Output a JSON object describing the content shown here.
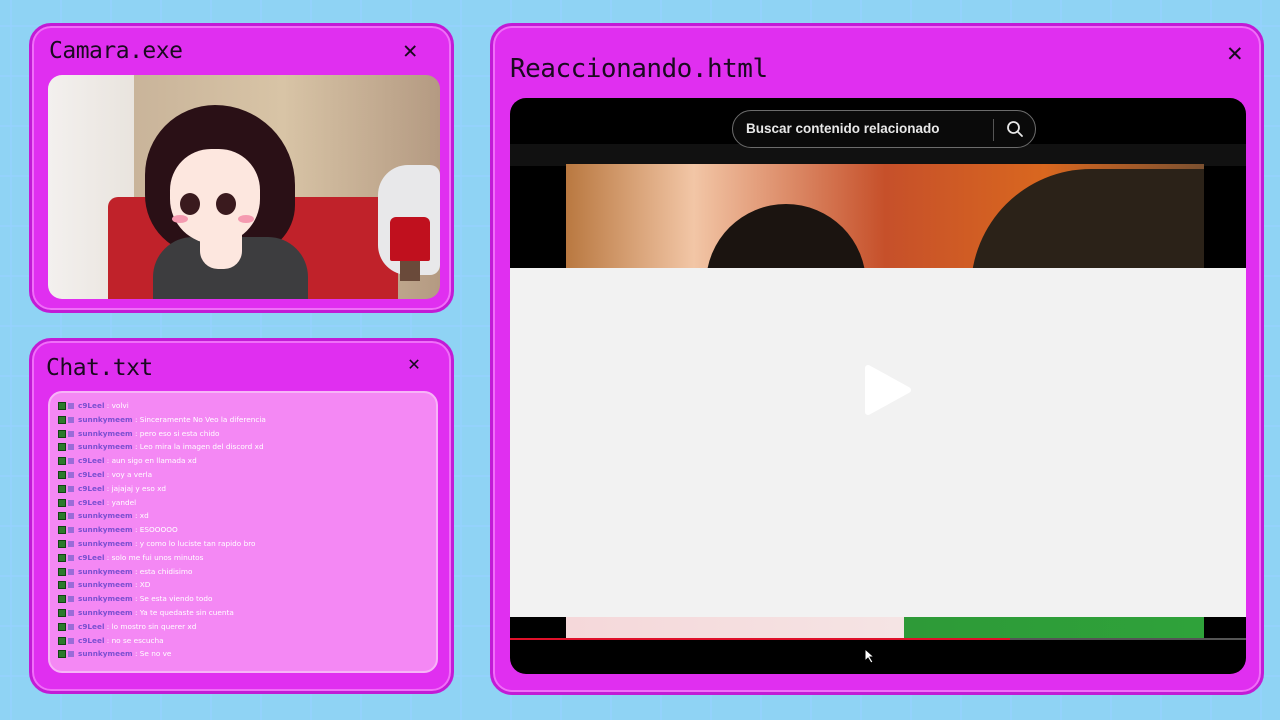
{
  "camera_window": {
    "title": "Camara.exe",
    "close": "✕"
  },
  "chat_window": {
    "title": "Chat.txt",
    "close": "✕",
    "messages": [
      {
        "user": "c9Leel",
        "text": "volvi"
      },
      {
        "user": "sunnkymeem",
        "text": "Sinceramente No Veo la diferencia"
      },
      {
        "user": "sunnkymeem",
        "text": "pero eso si esta chido"
      },
      {
        "user": "sunnkymeem",
        "text": "Leo mira la imagen del discord xd"
      },
      {
        "user": "c9Leel",
        "text": "aun sigo en llamada xd"
      },
      {
        "user": "c9Leel",
        "text": "voy a verla"
      },
      {
        "user": "c9Leel",
        "text": "jajajaj y eso xd"
      },
      {
        "user": "c9Leel",
        "text": "yandel"
      },
      {
        "user": "sunnkymeem",
        "text": "xd"
      },
      {
        "user": "sunnkymeem",
        "text": "ESOOOOO"
      },
      {
        "user": "sunnkymeem",
        "text": "y como lo luciste tan rapido bro"
      },
      {
        "user": "c9Leel",
        "text": "solo me fui unos minutos"
      },
      {
        "user": "sunnkymeem",
        "text": "esta chidisimo"
      },
      {
        "user": "sunnkymeem",
        "text": "XD"
      },
      {
        "user": "sunnkymeem",
        "text": "Se esta viendo todo"
      },
      {
        "user": "sunnkymeem",
        "text": "Ya te quedaste sin cuenta"
      },
      {
        "user": "c9Leel",
        "text": "lo mostro sin querer xd"
      },
      {
        "user": "c9Leel",
        "text": "no se escucha"
      },
      {
        "user": "sunnkymeem",
        "text": "Se no ve"
      }
    ]
  },
  "reaction_window": {
    "title": "Reaccionando.html",
    "close": "✕",
    "search": {
      "placeholder": "Buscar contenido relacionado"
    },
    "player": {
      "progress": 0.68
    },
    "colors": {
      "accent": "#e02ff0",
      "progress": "#e0102a"
    }
  }
}
